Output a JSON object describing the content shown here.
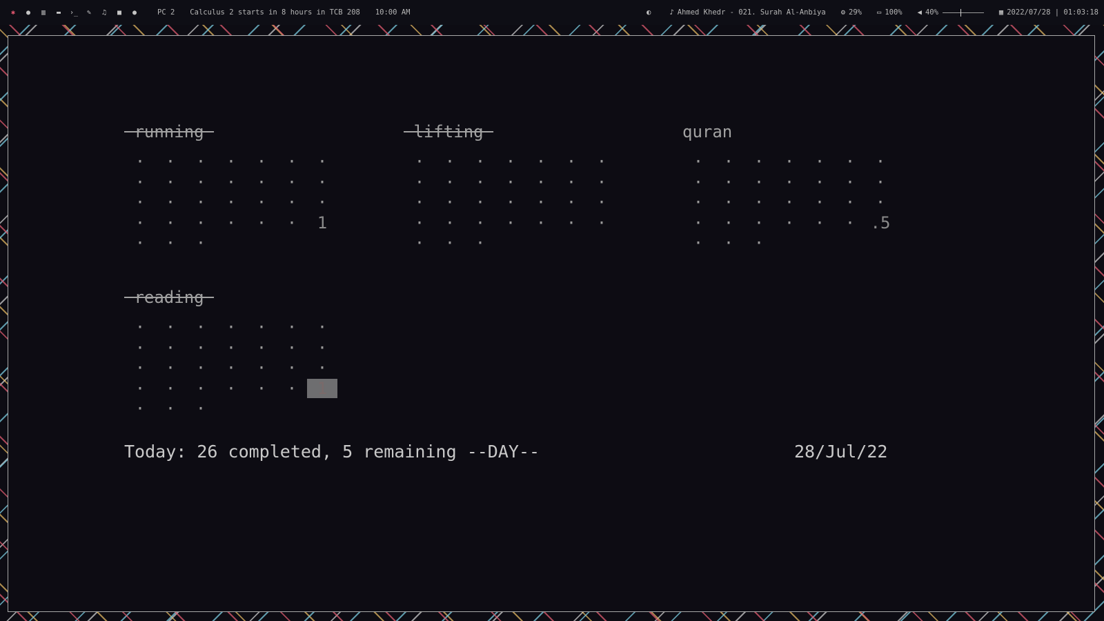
{
  "topbar": {
    "launcher_icons": [
      "app-menu-icon",
      "globe-icon",
      "bank-icon",
      "folder-icon",
      "terminal-icon",
      "edit-icon",
      "music-icon",
      "video-icon",
      "chat-icon"
    ],
    "workspace": "PC 2",
    "notice": "Calculus 2 starts in 8 hours in TCB 208",
    "event_time": "10:00 AM",
    "now_playing": "Ahmed Khedr - 021. Surah Al-Anbiya",
    "cpu": "29%",
    "battery": "100%",
    "volume": "40%",
    "volume_level": 0.4,
    "datetime": "2022/07/28 | 01:03:18"
  },
  "habits": [
    {
      "name": "running",
      "done": true,
      "cells": 31,
      "values": {
        "27": "1"
      },
      "selected": null
    },
    {
      "name": "lifting",
      "done": true,
      "cells": 31,
      "values": {},
      "selected": null
    },
    {
      "name": "quran",
      "done": false,
      "cells": 31,
      "values": {
        "27": ".5"
      },
      "selected": null
    },
    {
      "name": "reading",
      "done": true,
      "cells": 31,
      "values": {
        "27": "1"
      },
      "selected": 27
    }
  ],
  "dot_char": "·",
  "summary": "Today: 26 completed, 5 remaining --DAY--",
  "date": "28/Jul/22"
}
